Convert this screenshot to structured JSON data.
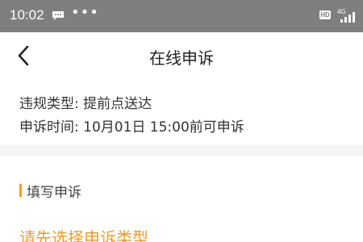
{
  "status_bar": {
    "time": "10:02",
    "dots": "•••",
    "hd": "HD",
    "network": "4G"
  },
  "header": {
    "title": "在线申诉"
  },
  "info": {
    "violation_type": "违规类型: 提前点送达",
    "appeal_time": "申诉时间: 10月01日 15:00前可申诉"
  },
  "form": {
    "section_title": "填写申诉",
    "type_placeholder": "请先选择申诉类型"
  },
  "colors": {
    "accent": "#f29b1c",
    "status_bar": "#7f7f7f"
  }
}
